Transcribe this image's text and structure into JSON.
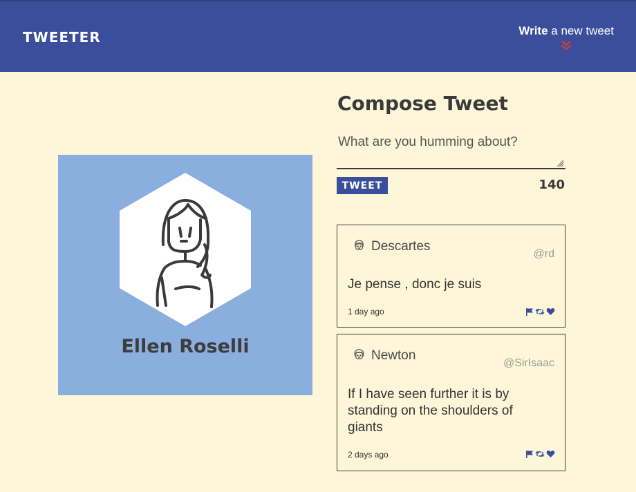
{
  "nav": {
    "brand": "TWEETER",
    "write_bold": "Write",
    "write_rest": " a new tweet",
    "arrow_icon": "double-chevron-down-icon"
  },
  "profile": {
    "name": "Ellen Roselli",
    "background_color": "#8aaedd"
  },
  "compose": {
    "title": "Compose Tweet",
    "placeholder": "What are you humming about?",
    "button_label": "TWEET",
    "char_count": "140"
  },
  "tweets": [
    {
      "name": "Descartes",
      "handle": "@rd",
      "text": "Je pense , donc je suis",
      "time": "1 day ago"
    },
    {
      "name": "Newton",
      "handle": "@SirIsaac",
      "text": "If I have seen further it is by standing on the shoulders of giants",
      "time": "2 days ago"
    }
  ],
  "colors": {
    "accent": "#3a4e9b",
    "background": "#fef6d8",
    "arrow": "#e03b2a"
  }
}
